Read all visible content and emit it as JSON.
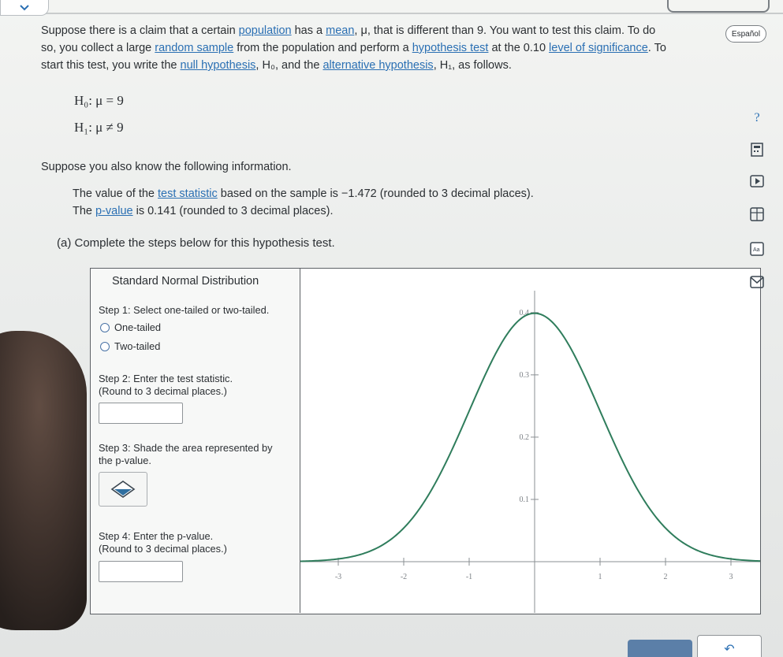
{
  "espanol_label": "Español",
  "problem": {
    "l1_a": "Suppose there is a claim that a certain ",
    "l1_link_population": "population",
    "l1_b": " has a ",
    "l1_link_mean": "mean",
    "l1_c": ", μ, that is different than 9. You want to test this claim. To do",
    "l2_a": "so, you collect a large ",
    "l2_link_random": "random sample",
    "l2_b": " from the population and perform a ",
    "l2_link_hypo": "hypothesis test",
    "l2_c": " at the 0.10 ",
    "l2_link_level": "level of significance",
    "l2_d": ". To",
    "l3_a": "start this test, you write the ",
    "l3_link_null": "null hypothesis",
    "l3_b": ", H₀, and the ",
    "l3_link_alt": "alternative hypothesis",
    "l3_c": ", H₁, as follows."
  },
  "hypotheses": {
    "h0": "H₀: μ = 9",
    "h1": "H₁: μ ≠ 9"
  },
  "info": {
    "intro": "Suppose you also know the following information.",
    "stat_a": "The value of the ",
    "stat_link": "test statistic",
    "stat_b": " based on the sample is −1.472 (rounded to 3 decimal places).",
    "p_a": "The ",
    "p_link": "p-value",
    "p_b": " is 0.141 (rounded to 3 decimal places)."
  },
  "part_a": "(a) Complete the steps below for this hypothesis test.",
  "panel": {
    "title": "Standard Normal Distribution",
    "step1": "Step 1: Select one-tailed or two-tailed.",
    "option_one": "One-tailed",
    "option_two": "Two-tailed",
    "step2_l1": "Step 2: Enter the test statistic.",
    "step2_l2": "(Round to 3 decimal places.)",
    "step3_l1": "Step 3: Shade the area represented by",
    "step3_l2": "the p-value.",
    "step4_l1": "Step 4: Enter the p-value.",
    "step4_l2": "(Round to 3 decimal places.)",
    "stat_value": "",
    "p_value": ""
  },
  "chart_data": {
    "type": "line",
    "x_ticks": [
      -3,
      -2,
      -1,
      0,
      1,
      2,
      3
    ],
    "x_tick_labels": [
      "-3",
      "-2",
      "-1",
      "",
      "1",
      "2",
      "3"
    ],
    "y_ticks": [
      0.1,
      0.2,
      0.3,
      0.4
    ],
    "y_tick_labels": [
      "0.1",
      "0.2",
      "0.3",
      "0.4"
    ],
    "xlim": [
      -3.5,
      3.5
    ],
    "ylim": [
      0,
      0.42
    ],
    "curve_color": "#2f7d5c"
  },
  "bottom_btn_2_glyph": "↶"
}
